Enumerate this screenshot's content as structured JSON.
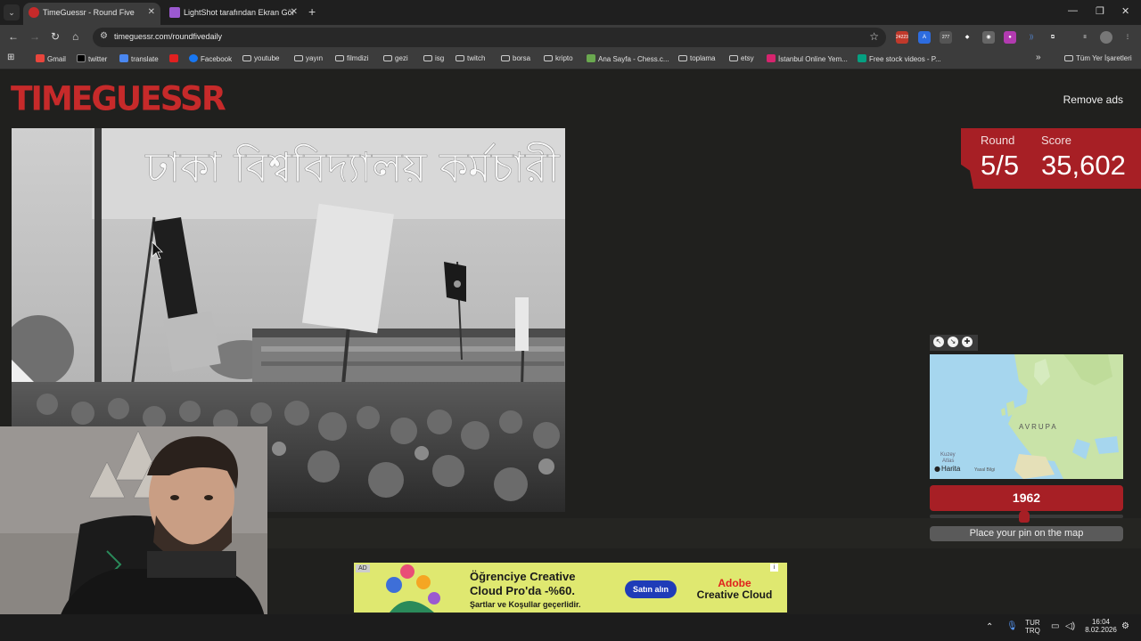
{
  "browser": {
    "tabs": [
      {
        "title": "TimeGuessr - Round Five",
        "active": true
      },
      {
        "title": "LightShot tarafından Ekran Gör",
        "active": false
      }
    ],
    "url": "timeguessr.com/roundfivedaily",
    "extension_badges": [
      "24223",
      "277"
    ],
    "bookmarks": [
      {
        "label": "Gmail",
        "icon": "gmail-icon"
      },
      {
        "label": "twitter",
        "icon": "x-icon"
      },
      {
        "label": "translate",
        "icon": "translate-icon"
      },
      {
        "label": "",
        "icon": "youtube-icon"
      },
      {
        "label": "Facebook",
        "icon": "facebook-icon"
      },
      {
        "label": "youtube",
        "icon": "folder-icon"
      },
      {
        "label": "yayın",
        "icon": "folder-icon"
      },
      {
        "label": "filmdizi",
        "icon": "folder-icon"
      },
      {
        "label": "gezi",
        "icon": "folder-icon"
      },
      {
        "label": "isg",
        "icon": "folder-icon"
      },
      {
        "label": "twitch",
        "icon": "folder-icon"
      },
      {
        "label": "borsa",
        "icon": "folder-icon"
      },
      {
        "label": "kripto",
        "icon": "folder-icon"
      },
      {
        "label": "Ana Sayfa - Chess.c...",
        "icon": "chess-icon"
      },
      {
        "label": "toplama",
        "icon": "folder-icon"
      },
      {
        "label": "etsy",
        "icon": "folder-icon"
      },
      {
        "label": "İstanbul Online Yem...",
        "icon": "yemek-icon"
      },
      {
        "label": "Free stock videos - P...",
        "icon": "pexels-icon"
      }
    ],
    "all_bookmarks": "Tüm Yer İşaretleri"
  },
  "game": {
    "logo": "TIMEGUESSR",
    "remove_ads": "Remove ads",
    "round_label": "Round",
    "round_value": "5/5",
    "score_label": "Score",
    "score_value": "35,602",
    "map_label_region": "AVRUPA",
    "map_label_kuzey": "Kuzey",
    "map_label_atlas": "Atlas",
    "map_brand": "Harita",
    "map_legal": "Yasal Bilgi",
    "year": "1962",
    "place_pin": "Place your pin on the map",
    "banner_text": "ঢাকা বিশ্ববিদ্যালয় কর্মচারী"
  },
  "ad": {
    "tag": "AD",
    "headline1": "Öğrenciye Creative",
    "headline2": "Cloud Pro'da -%60.",
    "terms": "Şartlar ve Koşullar geçerlidir.",
    "cta": "Satın alın",
    "brand1": "Adobe",
    "brand2": "Creative Cloud"
  },
  "taskbar": {
    "lang1": "TUR",
    "lang2": "TRQ",
    "time": "16:04",
    "date": "8.02.2026"
  },
  "colors": {
    "accent": "#a71f25",
    "logo": "#c62a2a",
    "page_bg": "#20201e"
  }
}
